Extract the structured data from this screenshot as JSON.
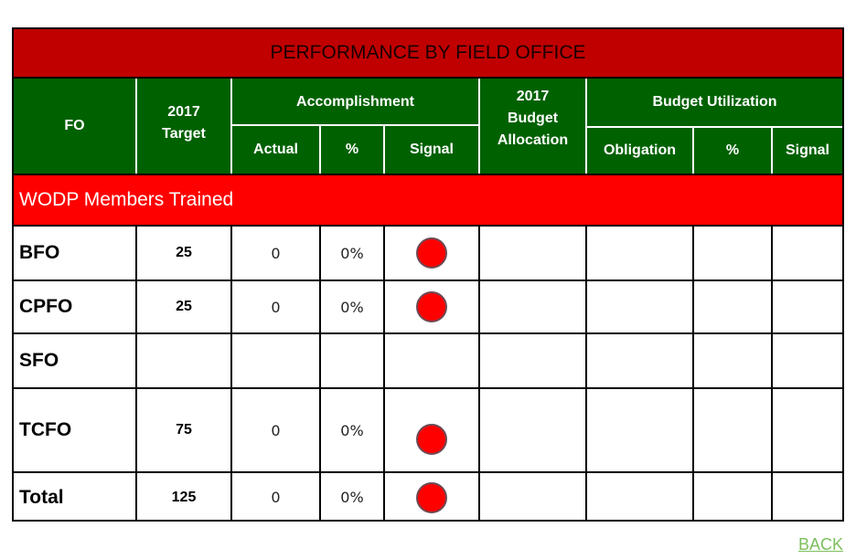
{
  "title": "PERFORMANCE BY FIELD OFFICE",
  "header": {
    "fo": "FO",
    "target_line1": "2017",
    "target_line2": "Target",
    "accomplishment": "Accomplishment",
    "actual": "Actual",
    "acc_percent": "%",
    "acc_signal": "Signal",
    "budget_line1": "2017",
    "budget_line2": "Budget",
    "budget_line3": "Allocation",
    "budget_utilization": "Budget Utilization",
    "obligation": "Obligation",
    "bu_percent": "%",
    "bu_signal": "Signal"
  },
  "section_label": "WODP Members Trained",
  "colors": {
    "title_bg": "#c00000",
    "header_bg": "#006100",
    "section_bg": "#ff0000",
    "signal_red": "#ff0000",
    "back_link": "#7cbf5c"
  },
  "rows": [
    {
      "fo": "BFO",
      "target": "25",
      "actual": "0",
      "percent": "0%",
      "signal": "red",
      "allocation": "",
      "obligation": "",
      "bu_percent": "",
      "bu_signal": ""
    },
    {
      "fo": "CPFO",
      "target": "25",
      "actual": "0",
      "percent": "0%",
      "signal": "red",
      "allocation": "",
      "obligation": "",
      "bu_percent": "",
      "bu_signal": ""
    },
    {
      "fo": "SFO",
      "target": "",
      "actual": "",
      "percent": "",
      "signal": "",
      "allocation": "",
      "obligation": "",
      "bu_percent": "",
      "bu_signal": ""
    },
    {
      "fo": "TCFO",
      "target": "75",
      "actual": "0",
      "percent": "0%",
      "signal": "red",
      "allocation": "",
      "obligation": "",
      "bu_percent": "",
      "bu_signal": ""
    },
    {
      "fo": "Total",
      "target": "125",
      "actual": "0",
      "percent": "0%",
      "signal": "red",
      "allocation": "",
      "obligation": "",
      "bu_percent": "",
      "bu_signal": ""
    }
  ],
  "back_link": "BACK"
}
